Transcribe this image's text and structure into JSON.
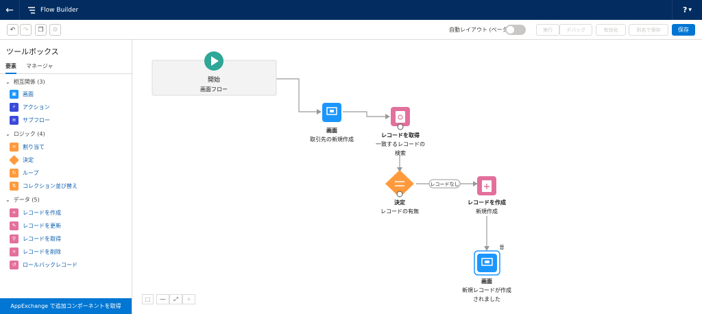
{
  "topbar": {
    "app_name": "Flow Builder",
    "help": "?"
  },
  "toolbar": {
    "auto_layout_label": "自動レイアウト (ベータ)",
    "buttons": [
      "実行",
      "デバッグ",
      "有効化",
      "別名で保存"
    ],
    "save": "保存"
  },
  "sidebar": {
    "title": "ツールボックス",
    "tabs": [
      "要素",
      "マネージャ"
    ],
    "sections": [
      {
        "label": "相互関係 (3)",
        "items": [
          "画面",
          "アクション",
          "サブフロー"
        ]
      },
      {
        "label": "ロジック (4)",
        "items": [
          "割り当て",
          "決定",
          "ループ",
          "コレクション並び替え"
        ]
      },
      {
        "label": "データ (5)",
        "items": [
          "レコードを作成",
          "レコードを更新",
          "レコードを取得",
          "レコードを削除",
          "ロールバックレコード"
        ]
      }
    ],
    "appexchange": "AppExchange で追加コンポーネントを取得"
  },
  "canvas": {
    "start": {
      "title": "開始",
      "subtitle": "画面フロー"
    },
    "screen1": {
      "title": "画面",
      "subtitle": "取引先の新規作成"
    },
    "get_record": {
      "title": "レコードを取得",
      "subtitle_line1": "一致するレコードの",
      "subtitle_line2": "検索"
    },
    "decision": {
      "title": "決定",
      "subtitle": "レコードの有無"
    },
    "connector_label": "レコードなし",
    "create_record": {
      "title": "レコードを作成",
      "subtitle": "新規作成"
    },
    "screen2": {
      "title": "画面",
      "subtitle_line1": "新規レコードが作成",
      "subtitle_line2": "されました"
    },
    "marker": "音"
  },
  "colors": {
    "nav": "#032d60",
    "brand": "#0176d3",
    "screen": "#1b96ff",
    "data": "#e3709c",
    "logic": "#ff9a3c",
    "start": "#2ea797"
  }
}
